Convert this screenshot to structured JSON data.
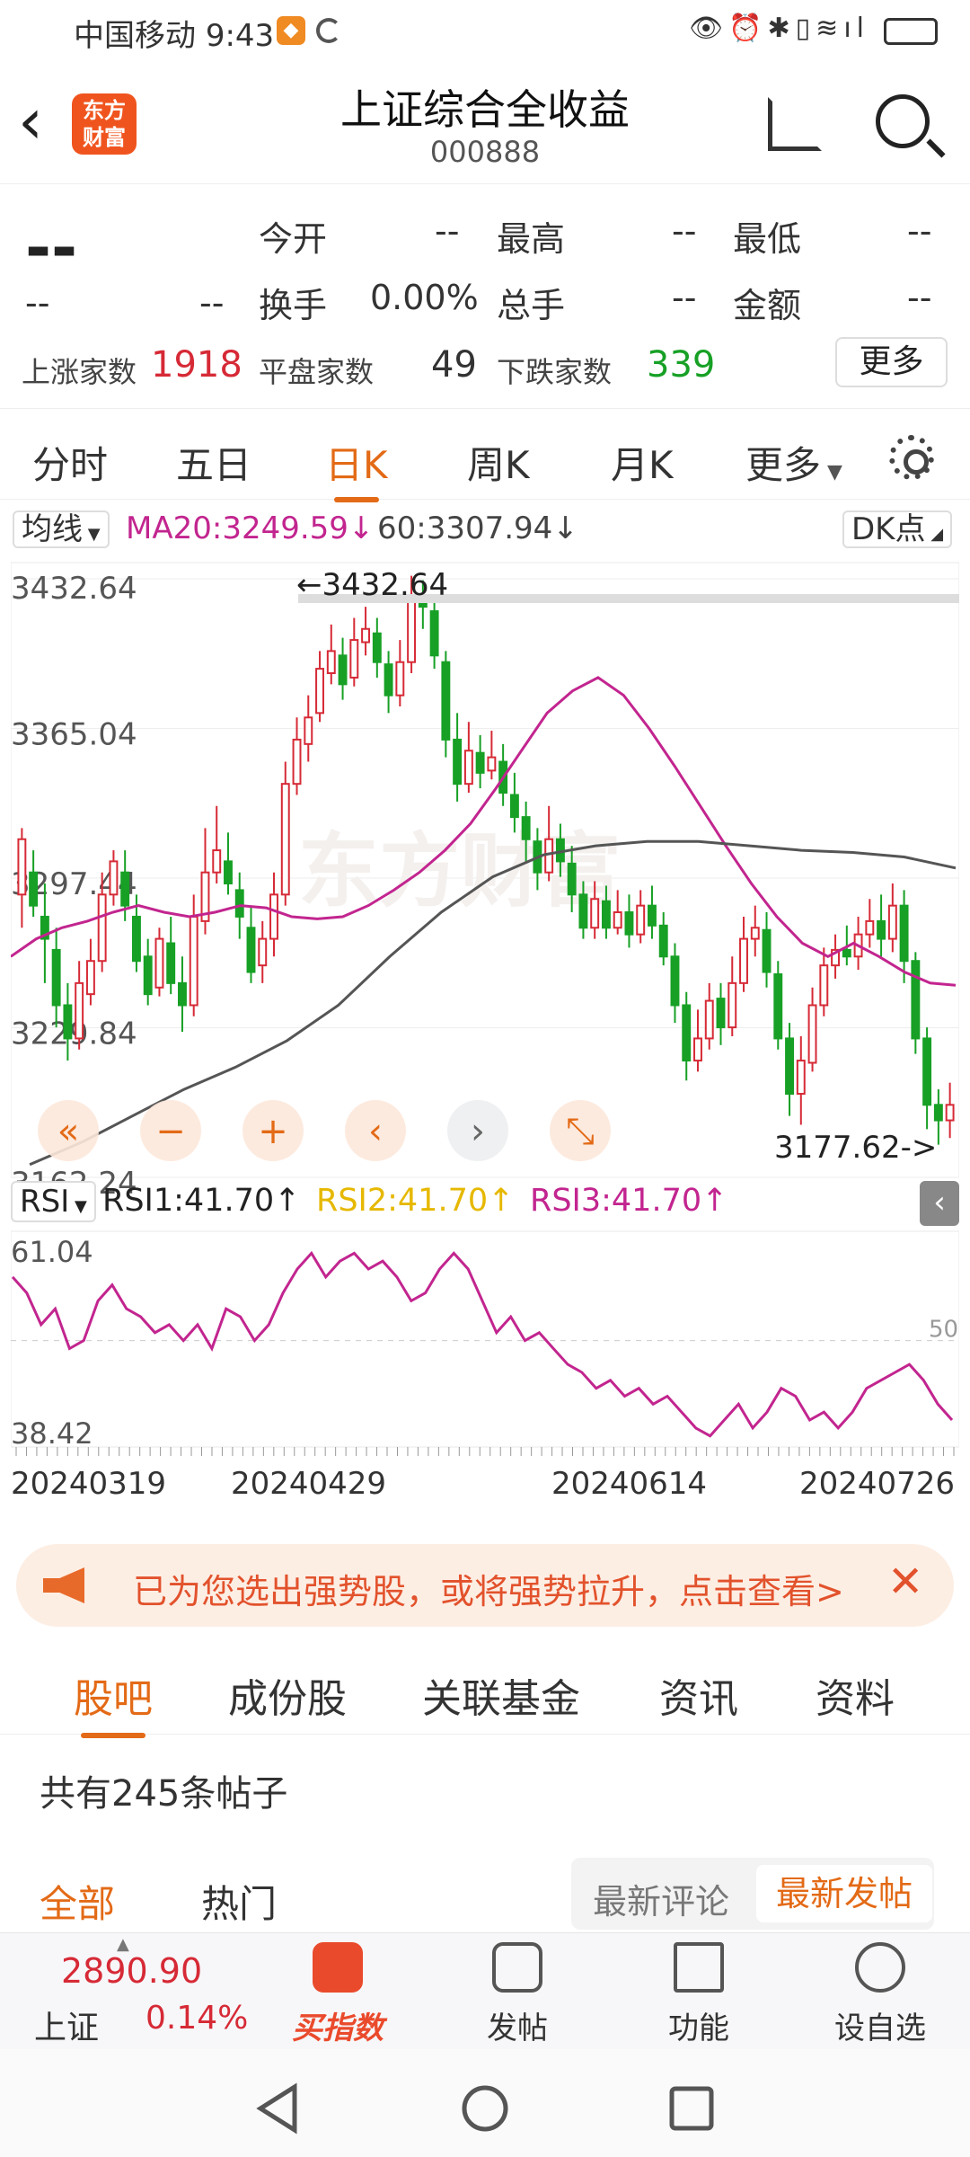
{
  "status": {
    "carrier": "中国移动",
    "time": "9:43"
  },
  "header": {
    "back_icon": "chevron-left-icon",
    "logo_text": "东方\n财富",
    "title": "上证综合全收益",
    "code": "000888"
  },
  "quote": {
    "price": "--",
    "change_left": "--",
    "change_right": "--",
    "rows": [
      [
        {
          "label": "今开",
          "value": "--"
        },
        {
          "label": "最高",
          "value": "--"
        },
        {
          "label": "最低",
          "value": "--"
        }
      ],
      [
        {
          "label": "换手",
          "value": "0.00%"
        },
        {
          "label": "总手",
          "value": "--"
        },
        {
          "label": "金额",
          "value": "--"
        }
      ]
    ],
    "up_label": "上涨家数",
    "up_value": "1918",
    "flat_label": "平盘家数",
    "flat_value": "49",
    "down_label": "下跌家数",
    "down_value": "339",
    "more_label": "更多"
  },
  "period_tabs": [
    "分时",
    "五日",
    "日K",
    "周K",
    "月K",
    "更多"
  ],
  "active_tab": 2,
  "kbar": {
    "ma_chip": "均线",
    "ma20": "MA20:3249.59↓",
    "ma60": "60:3307.94↓",
    "dk_chip": "DK点"
  },
  "chart_data": [
    {
      "type": "candlestick",
      "x_labels": [
        "20240319",
        "20240429",
        "20240614",
        "20240726"
      ],
      "y_ticks": [
        3432.64,
        3365.04,
        3297.44,
        3229.84,
        3162.24
      ],
      "ylim": [
        3162.24,
        3432.64
      ],
      "annotations": [
        {
          "text": "←3432.64",
          "value": 3432.64
        },
        {
          "text": "3177.62->",
          "value": 3177.62
        }
      ],
      "watermark": "东方财富",
      "candles": [
        [
          3290,
          3315,
          3320,
          3275
        ],
        [
          3300,
          3285,
          3310,
          3280
        ],
        [
          3280,
          3270,
          3295,
          3250
        ],
        [
          3265,
          3240,
          3275,
          3230
        ],
        [
          3240,
          3225,
          3250,
          3215
        ],
        [
          3225,
          3250,
          3260,
          3220
        ],
        [
          3245,
          3260,
          3270,
          3240
        ],
        [
          3260,
          3290,
          3300,
          3255
        ],
        [
          3290,
          3305,
          3310,
          3285
        ],
        [
          3300,
          3285,
          3310,
          3278
        ],
        [
          3280,
          3260,
          3290,
          3255
        ],
        [
          3262,
          3245,
          3270,
          3240
        ],
        [
          3248,
          3270,
          3275,
          3244
        ],
        [
          3268,
          3250,
          3280,
          3245
        ],
        [
          3250,
          3240,
          3262,
          3228
        ],
        [
          3240,
          3280,
          3290,
          3235
        ],
        [
          3278,
          3300,
          3320,
          3272
        ],
        [
          3300,
          3310,
          3330,
          3295
        ],
        [
          3305,
          3295,
          3318,
          3290
        ],
        [
          3292,
          3280,
          3300,
          3270
        ],
        [
          3275,
          3255,
          3285,
          3250
        ],
        [
          3258,
          3270,
          3278,
          3250
        ],
        [
          3270,
          3290,
          3300,
          3262
        ],
        [
          3290,
          3340,
          3350,
          3285
        ],
        [
          3340,
          3360,
          3370,
          3335
        ],
        [
          3358,
          3370,
          3380,
          3350
        ],
        [
          3372,
          3392,
          3400,
          3368
        ],
        [
          3390,
          3400,
          3412,
          3385
        ],
        [
          3398,
          3385,
          3406,
          3378
        ],
        [
          3388,
          3405,
          3415,
          3384
        ],
        [
          3404,
          3410,
          3420,
          3398
        ],
        [
          3408,
          3395,
          3415,
          3388
        ],
        [
          3394,
          3380,
          3400,
          3372
        ],
        [
          3380,
          3395,
          3405,
          3375
        ],
        [
          3395,
          3425,
          3434,
          3390
        ],
        [
          3425,
          3420,
          3432,
          3410
        ],
        [
          3418,
          3398,
          3425,
          3392
        ],
        [
          3395,
          3360,
          3400,
          3352
        ],
        [
          3360,
          3340,
          3372,
          3332
        ],
        [
          3340,
          3355,
          3368,
          3336
        ],
        [
          3354,
          3345,
          3362,
          3338
        ],
        [
          3346,
          3352,
          3364,
          3342
        ],
        [
          3350,
          3336,
          3358,
          3330
        ],
        [
          3335,
          3325,
          3345,
          3318
        ],
        [
          3325,
          3315,
          3332,
          3305
        ],
        [
          3314,
          3300,
          3320,
          3292
        ],
        [
          3300,
          3315,
          3330,
          3296
        ],
        [
          3315,
          3305,
          3322,
          3298
        ],
        [
          3304,
          3290,
          3312,
          3282
        ],
        [
          3290,
          3275,
          3296,
          3270
        ],
        [
          3275,
          3288,
          3296,
          3270
        ],
        [
          3287,
          3275,
          3294,
          3270
        ],
        [
          3275,
          3282,
          3292,
          3272
        ],
        [
          3282,
          3272,
          3290,
          3266
        ],
        [
          3272,
          3285,
          3292,
          3268
        ],
        [
          3285,
          3276,
          3294,
          3270
        ],
        [
          3276,
          3262,
          3282,
          3258
        ],
        [
          3262,
          3240,
          3268,
          3232
        ],
        [
          3240,
          3215,
          3246,
          3206
        ],
        [
          3215,
          3225,
          3238,
          3210
        ],
        [
          3225,
          3242,
          3250,
          3220
        ],
        [
          3243,
          3230,
          3250,
          3222
        ],
        [
          3230,
          3250,
          3262,
          3226
        ],
        [
          3250,
          3270,
          3280,
          3246
        ],
        [
          3270,
          3275,
          3285,
          3262
        ],
        [
          3274,
          3255,
          3282,
          3248
        ],
        [
          3254,
          3225,
          3260,
          3220
        ],
        [
          3225,
          3200,
          3232,
          3190
        ],
        [
          3200,
          3215,
          3226,
          3186
        ],
        [
          3214,
          3240,
          3248,
          3210
        ],
        [
          3240,
          3258,
          3266,
          3235
        ],
        [
          3258,
          3265,
          3272,
          3252
        ],
        [
          3265,
          3262,
          3276,
          3258
        ],
        [
          3262,
          3272,
          3280,
          3256
        ],
        [
          3272,
          3278,
          3288,
          3266
        ],
        [
          3278,
          3270,
          3290,
          3262
        ],
        [
          3270,
          3285,
          3295,
          3264
        ],
        [
          3285,
          3260,
          3292,
          3250
        ],
        [
          3260,
          3225,
          3264,
          3218
        ],
        [
          3225,
          3195,
          3230,
          3184
        ],
        [
          3195,
          3188,
          3202,
          3177
        ],
        [
          3188,
          3195,
          3205,
          3180
        ]
      ],
      "ma20": [
        3262,
        3270,
        3275,
        3278,
        3282,
        3285,
        3282,
        3280,
        3282,
        3285,
        3284,
        3280,
        3279,
        3280,
        3285,
        3292,
        3300,
        3310,
        3322,
        3338,
        3355,
        3372,
        3382,
        3388,
        3380,
        3365,
        3348,
        3330,
        3312,
        3295,
        3280,
        3268,
        3262,
        3268,
        3262,
        3255,
        3250,
        3249
      ],
      "ma60": [
        3168,
        3178,
        3190,
        3202,
        3212,
        3224,
        3240,
        3262,
        3282,
        3298,
        3308,
        3312,
        3314,
        3314,
        3312,
        3310,
        3309,
        3307,
        3302
      ]
    },
    {
      "type": "line",
      "title": "RSI",
      "series": [
        {
          "name": "RSI1",
          "label": "RSI1:41.70↑",
          "color": "#222222"
        },
        {
          "name": "RSI2",
          "label": "RSI2:41.70↑",
          "color": "#e6b800"
        },
        {
          "name": "RSI3",
          "label": "RSI3:41.70↑",
          "color": "#c2258f"
        }
      ],
      "y_ticks": [
        61.04,
        38.42
      ],
      "ref_line": 50,
      "values": [
        58,
        56,
        52,
        54,
        49,
        50,
        55,
        57,
        54,
        53,
        51,
        52,
        50,
        52,
        49,
        54,
        53,
        50,
        52,
        56,
        59,
        61,
        58,
        60,
        61,
        59,
        60,
        58,
        55,
        56,
        59,
        61,
        59,
        55,
        51,
        53,
        50,
        51,
        49,
        47,
        46,
        44,
        45,
        43,
        44,
        42,
        43,
        41,
        39,
        38,
        40,
        42,
        39,
        41,
        44,
        43,
        40,
        41,
        39,
        41,
        44,
        45,
        46,
        47,
        45,
        42,
        40
      ]
    }
  ],
  "rsi_header": {
    "chip": "RSI",
    "r1": "RSI1:41.70↑",
    "r2": "RSI2:41.70↑",
    "r3": "RSI3:41.70↑"
  },
  "banner": {
    "text": "已为您选出强势股，或将强势拉升，点击查看>",
    "close": "✕"
  },
  "bottom_tabs": [
    "股吧",
    "成份股",
    "关联基金",
    "资讯",
    "资料"
  ],
  "posts": {
    "count_text": "共有245条帖子",
    "filters": [
      "全部",
      "热门"
    ],
    "sort": [
      "最新评论",
      "最新发帖"
    ]
  },
  "dock": {
    "index_value": "2890.90",
    "index_name": "上证",
    "index_pct": "0.14%",
    "buy_label": "买指数",
    "items": [
      "发帖",
      "功能",
      "设自选"
    ]
  }
}
